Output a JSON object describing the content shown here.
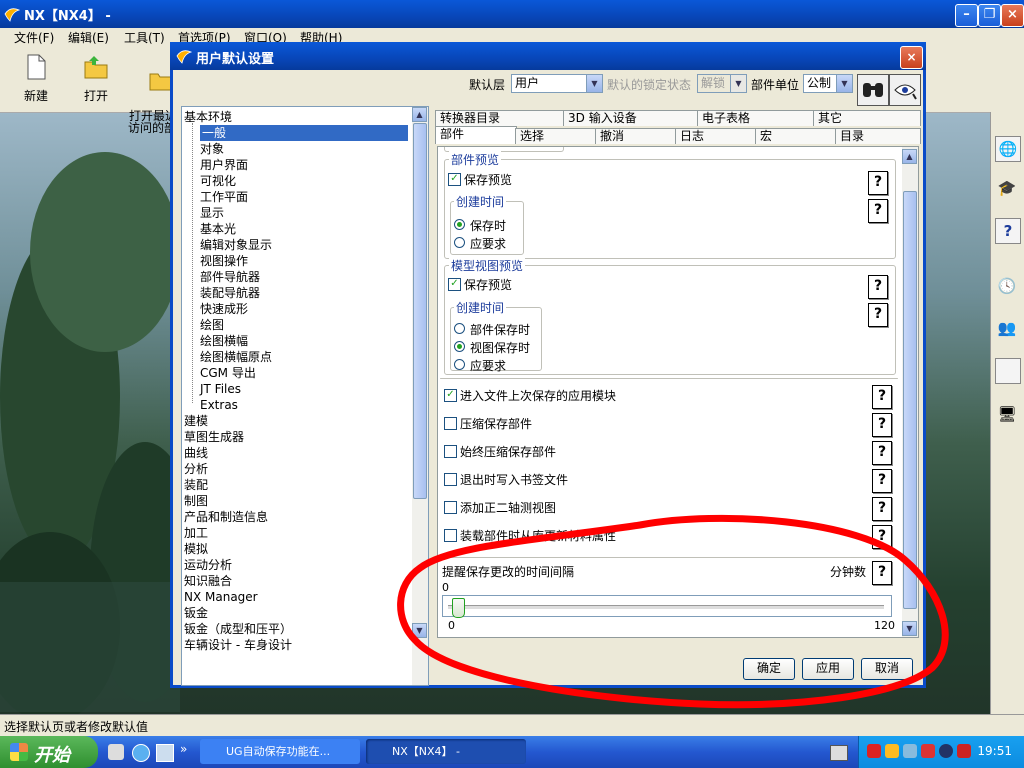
{
  "app": {
    "title": "NX【NX4】 -",
    "menu": [
      "文件(F)",
      "编辑(E)",
      "工具(T)",
      "首选项(P)",
      "窗口(O)",
      "帮助(H)"
    ],
    "toolbar": [
      {
        "label": "新建",
        "icon": "new-file-icon"
      },
      {
        "label": "打开",
        "icon": "open-folder-icon"
      },
      {
        "label": "打开最近\n访问的部件",
        "icon": "open-recent-icon"
      }
    ],
    "status": "选择默认页或者修改默认值"
  },
  "dialog": {
    "title": "用户默认设置",
    "default_layer_label": "默认层",
    "default_layer_value": "用户",
    "lock_state_label": "默认的锁定状态",
    "lock_state_value": "解锁",
    "units_label": "部件单位",
    "units_value": "公制",
    "tree": {
      "items": [
        {
          "label": "基本环境",
          "indent": 0,
          "selected": false
        },
        {
          "label": "一般",
          "indent": 1,
          "selected": true
        },
        {
          "label": "对象",
          "indent": 1,
          "selected": false
        },
        {
          "label": "用户界面",
          "indent": 1,
          "selected": false
        },
        {
          "label": "可视化",
          "indent": 1,
          "selected": false
        },
        {
          "label": "工作平面",
          "indent": 1,
          "selected": false
        },
        {
          "label": "显示",
          "indent": 1,
          "selected": false
        },
        {
          "label": "基本光",
          "indent": 1,
          "selected": false
        },
        {
          "label": "编辑对象显示",
          "indent": 1,
          "selected": false
        },
        {
          "label": "视图操作",
          "indent": 1,
          "selected": false
        },
        {
          "label": "部件导航器",
          "indent": 1,
          "selected": false
        },
        {
          "label": "装配导航器",
          "indent": 1,
          "selected": false
        },
        {
          "label": "快速成形",
          "indent": 1,
          "selected": false
        },
        {
          "label": "绘图",
          "indent": 1,
          "selected": false
        },
        {
          "label": "绘图横幅",
          "indent": 1,
          "selected": false
        },
        {
          "label": "绘图横幅原点",
          "indent": 1,
          "selected": false
        },
        {
          "label": "CGM 导出",
          "indent": 1,
          "selected": false
        },
        {
          "label": "JT Files",
          "indent": 1,
          "selected": false
        },
        {
          "label": "Extras",
          "indent": 1,
          "selected": false
        },
        {
          "label": "建模",
          "indent": 0,
          "selected": false
        },
        {
          "label": "草图生成器",
          "indent": 0,
          "selected": false
        },
        {
          "label": "曲线",
          "indent": 0,
          "selected": false
        },
        {
          "label": "分析",
          "indent": 0,
          "selected": false
        },
        {
          "label": "装配",
          "indent": 0,
          "selected": false
        },
        {
          "label": "制图",
          "indent": 0,
          "selected": false
        },
        {
          "label": "产品和制造信息",
          "indent": 0,
          "selected": false
        },
        {
          "label": "加工",
          "indent": 0,
          "selected": false
        },
        {
          "label": "模拟",
          "indent": 0,
          "selected": false
        },
        {
          "label": "运动分析",
          "indent": 0,
          "selected": false
        },
        {
          "label": "知识融合",
          "indent": 0,
          "selected": false
        },
        {
          "label": "NX Manager",
          "indent": 0,
          "selected": false
        },
        {
          "label": "钣金",
          "indent": 0,
          "selected": false
        },
        {
          "label": "钣金（成型和压平）",
          "indent": 0,
          "selected": false
        },
        {
          "label": "车辆设计 - 车身设计",
          "indent": 0,
          "selected": false
        }
      ]
    },
    "tabs_row1": [
      "转换器目录",
      "3D 输入设备",
      "电子表格",
      "其它"
    ],
    "tabs_row2": [
      "部件",
      "选择",
      "撤消",
      "日志",
      "宏",
      "目录"
    ],
    "part_preview": {
      "title": "部件预览",
      "save_preview": "保存预览",
      "create_time_title": "创建时间",
      "options": [
        "保存时",
        "应要求"
      ]
    },
    "model_view_preview": {
      "title": "模型视图预览",
      "save_preview": "保存预览",
      "create_time_title": "创建时间",
      "options": [
        "部件保存时",
        "视图保存时",
        "应要求"
      ]
    },
    "checkboxes": [
      {
        "label": "进入文件上次保存的应用模块",
        "checked": true
      },
      {
        "label": "压缩保存部件",
        "checked": false
      },
      {
        "label": "始终压缩保存部件",
        "checked": false
      },
      {
        "label": "退出时写入书签文件",
        "checked": false
      },
      {
        "label": "添加正二轴测视图",
        "checked": false
      },
      {
        "label": "装载部件时从库更新材料属性",
        "checked": false
      }
    ],
    "reminder": {
      "label": "提醒保存更改的时间间隔",
      "unit": "分钟数",
      "value": "0",
      "min_label": "0",
      "max_label": "120",
      "level": 0.01
    },
    "buttons": {
      "ok": "确定",
      "apply": "应用",
      "cancel": "取消"
    },
    "help_glyph": "?"
  },
  "taskbar": {
    "start": "开始",
    "tasks": [
      "UG自动保存功能在...",
      "NX【NX4】 -"
    ],
    "clock": "19:51"
  },
  "colors": {
    "titlebar": "#0a4bc8",
    "selection": "#316ac5",
    "annotation": "#ff0000",
    "check": "#21a121"
  }
}
